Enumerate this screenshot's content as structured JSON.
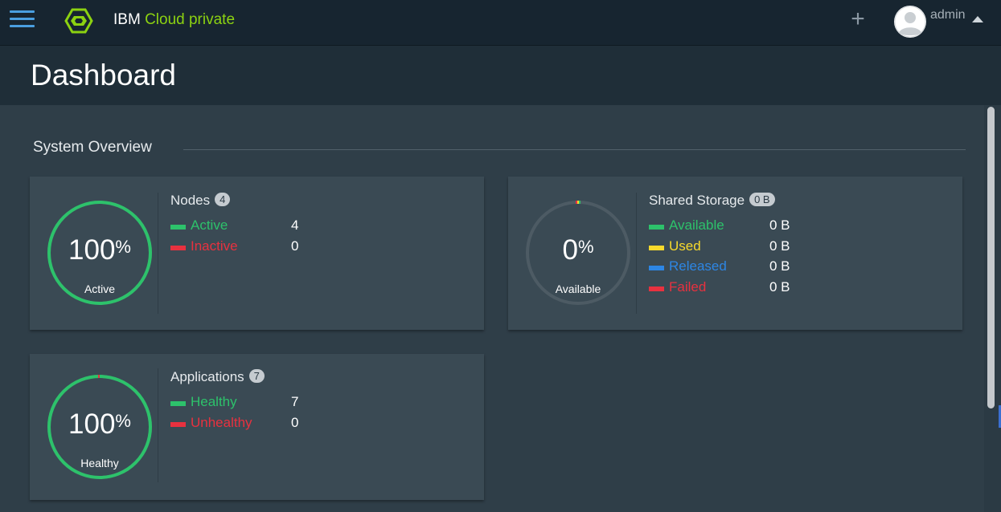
{
  "app": {
    "brand_ibm": "IBM",
    "brand_product": "Cloud private",
    "user_name": "admin",
    "add_label": "+"
  },
  "page": {
    "title": "Dashboard",
    "section_title": "System Overview"
  },
  "colors": {
    "green": "#2dc26b",
    "red": "#e8313f",
    "yellow": "#f7d92c",
    "blue": "#2d86e4",
    "ring_track": "#4d5b64"
  },
  "nodes": {
    "title": "Nodes",
    "count": "4",
    "percent": "100",
    "percent_suffix": "%",
    "ring_label": "Active",
    "fill_fraction": 1.0,
    "items": [
      {
        "label": "Active",
        "value": "4",
        "color": "#2dc26b"
      },
      {
        "label": "Inactive",
        "value": "0",
        "color": "#e8313f"
      }
    ]
  },
  "storage": {
    "title": "Shared Storage",
    "count": "0 B",
    "percent": "0",
    "percent_suffix": "%",
    "ring_label": "Available",
    "fill_fraction": 0.0,
    "items": [
      {
        "label": "Available",
        "value": "0 B",
        "color": "#2dc26b"
      },
      {
        "label": "Used",
        "value": "0 B",
        "color": "#f7d92c"
      },
      {
        "label": "Released",
        "value": "0 B",
        "color": "#2d86e4"
      },
      {
        "label": "Failed",
        "value": "0 B",
        "color": "#e8313f"
      }
    ]
  },
  "applications": {
    "title": "Applications",
    "count": "7",
    "percent": "100",
    "percent_suffix": "%",
    "ring_label": "Healthy",
    "fill_fraction": 1.0,
    "items": [
      {
        "label": "Healthy",
        "value": "7",
        "color": "#2dc26b"
      },
      {
        "label": "Unhealthy",
        "value": "0",
        "color": "#e8313f"
      }
    ]
  }
}
